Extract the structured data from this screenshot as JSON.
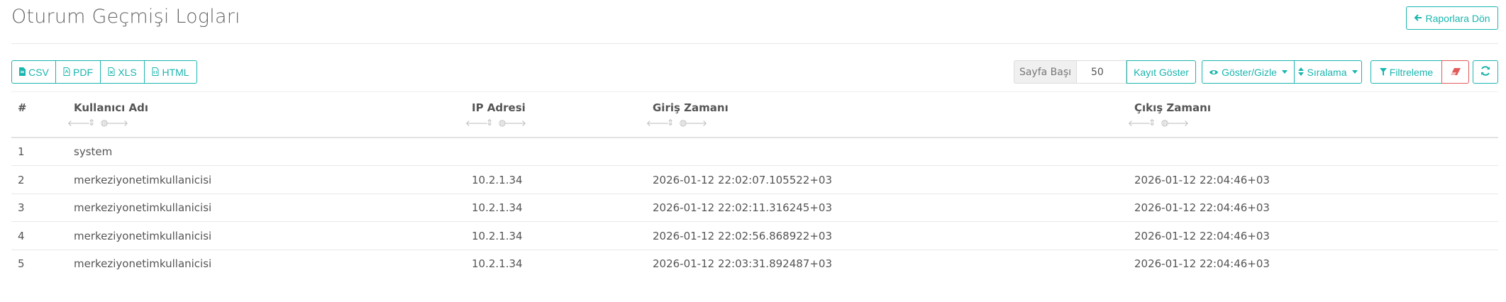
{
  "page": {
    "title": "Oturum Geçmişi Logları",
    "back_label": "Raporlara Dön"
  },
  "export": {
    "csv": "CSV",
    "pdf": "PDF",
    "xls": "XLS",
    "html": "HTML"
  },
  "toolbar": {
    "page_size_label": "Sayfa Başı",
    "page_size_value": "50",
    "show_records": "Kayıt Göster",
    "show_hide": "Göster/Gizle",
    "sorting": "Sıralama",
    "filter": "Filtreleme"
  },
  "table": {
    "columns": [
      "#",
      "Kullanıcı Adı",
      "IP Adresi",
      "Giriş Zamanı",
      "Çıkış Zamanı"
    ],
    "rows": [
      [
        "1",
        "system",
        "",
        "",
        ""
      ],
      [
        "2",
        "merkeziyonetimkullanicisi",
        "10.2.1.34",
        "2026-01-12 22:02:07.105522+03",
        "2026-01-12 22:04:46+03"
      ],
      [
        "3",
        "merkeziyonetimkullanicisi",
        "10.2.1.34",
        "2026-01-12 22:02:11.316245+03",
        "2026-01-12 22:04:46+03"
      ],
      [
        "4",
        "merkeziyonetimkullanicisi",
        "10.2.1.34",
        "2026-01-12 22:02:56.868922+03",
        "2026-01-12 22:04:46+03"
      ],
      [
        "5",
        "merkeziyonetimkullanicisi",
        "10.2.1.34",
        "2026-01-12 22:03:31.892487+03",
        "2026-01-12 22:04:46+03"
      ]
    ]
  },
  "colors": {
    "accent": "#1ab5ae",
    "danger": "#e05a5a"
  }
}
